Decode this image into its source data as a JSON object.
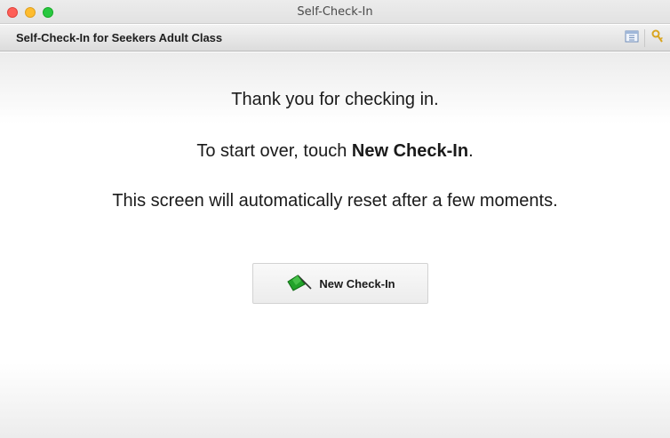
{
  "window": {
    "title": "Self-Check-In"
  },
  "header": {
    "title": "Self-Check-In for Seekers Adult Class"
  },
  "main": {
    "line1": "Thank you for checking in.",
    "line2_prefix": "To start over, touch ",
    "line2_bold": "New Check-In",
    "line2_suffix": ".",
    "line3": "This screen will automatically reset after a few moments."
  },
  "button": {
    "label": "New Check-In",
    "icon": "green-flag-icon"
  },
  "tools": [
    {
      "icon": "window-layout-icon"
    },
    {
      "icon": "key-icon"
    }
  ],
  "colors": {
    "flag_green": "#22a22a",
    "close": "#fe5f57",
    "minimize": "#febc2e",
    "zoom": "#28c840"
  }
}
